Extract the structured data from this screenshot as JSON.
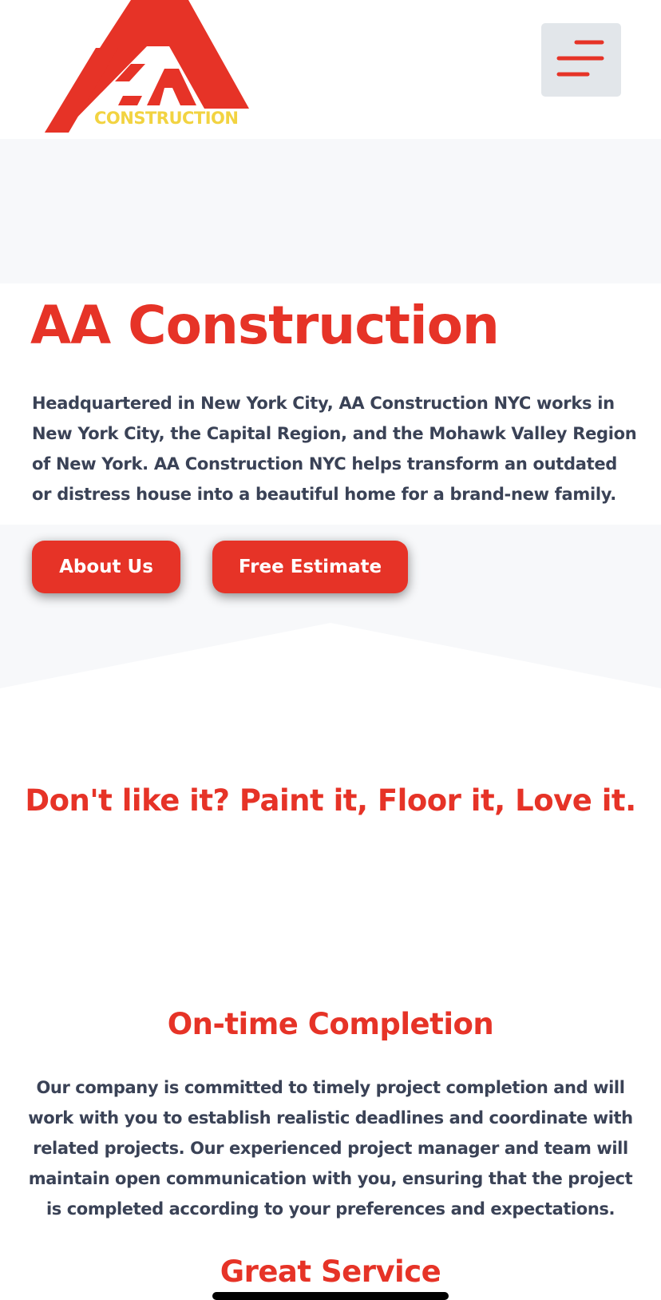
{
  "header": {
    "logo_wordmark": "CONSTRUCTION",
    "logo_mark": "AA",
    "menu_icon": "hamburger-menu-icon"
  },
  "hero": {
    "title": "AA Construction",
    "description": "Headquartered in New York City, AA Construction NYC works in New York City, the Capital Region, and the Mohawk Valley Region of New York.  AA Construction NYC helps transform an outdated or distress house into a beautiful home for a brand-new family.",
    "buttons": {
      "about": "About Us",
      "estimate": "Free Estimate"
    }
  },
  "tagline": "Don't like it? Paint it, Floor it, Love it.",
  "sections": {
    "ontime": {
      "title": "On-time Completion",
      "text": "Our company is committed to timely project completion and will work with you to establish realistic deadlines and coordinate with related projects. Our experienced project manager and team will maintain open communication with you, ensuring that the project is completed according to your preferences and expectations."
    },
    "service": {
      "title": "Great Service"
    }
  },
  "colors": {
    "brand_red": "#e63327",
    "brand_yellow": "#f2d341",
    "text_dark": "#3a4256",
    "band_gray": "#f7f8fa",
    "menu_bg": "#e2e6ea"
  }
}
